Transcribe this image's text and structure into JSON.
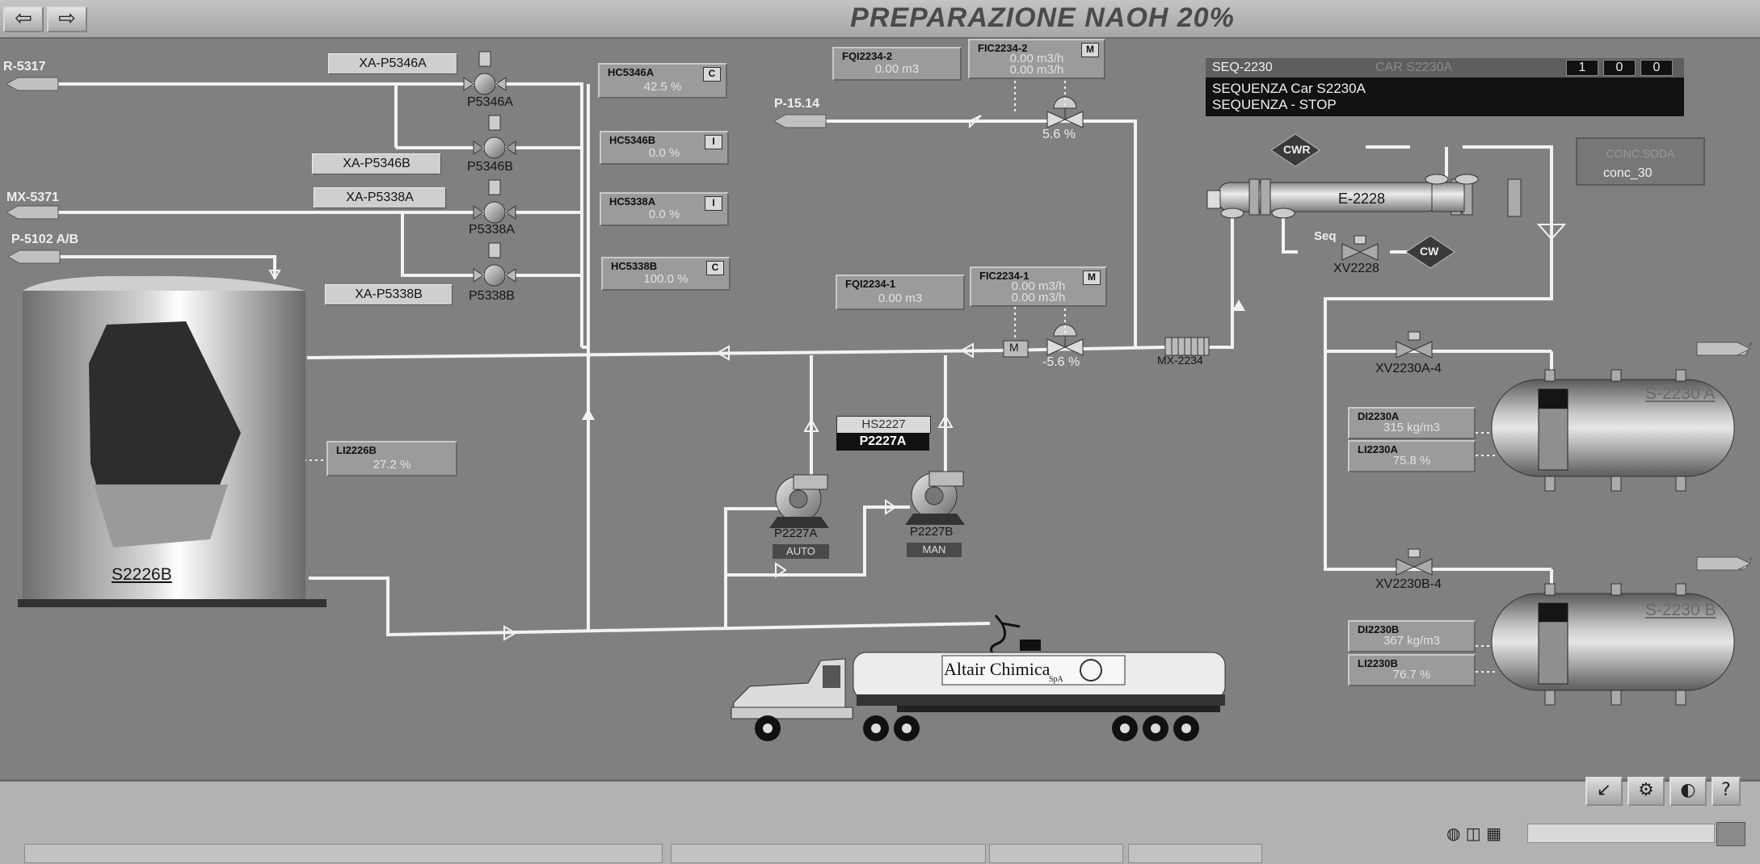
{
  "window": {
    "title": "PREPARAZIONE NAOH 20%",
    "nav_back": "⇦",
    "nav_forward": "⇨"
  },
  "lines": {
    "r5317": "R-5317",
    "mx5371": "MX-5371",
    "p5102": "P-5102 A/B",
    "p1514": "P-15.14"
  },
  "pumps": {
    "p5346a": {
      "tag": "P5346A",
      "xa": "XA-P5346A"
    },
    "p5346b": {
      "tag": "P5346B",
      "xa": "XA-P5346B"
    },
    "p5338a": {
      "tag": "P5338A",
      "xa": "XA-P5338A"
    },
    "p5338b": {
      "tag": "P5338B",
      "xa": "XA-P5338B"
    },
    "p2227a": {
      "tag": "P2227A",
      "mode": "AUTO"
    },
    "p2227b": {
      "tag": "P2227B",
      "mode": "MAN"
    }
  },
  "hand_controls": [
    {
      "tag": "HC5346A",
      "value": "42.5 %",
      "mode": "C"
    },
    {
      "tag": "HC5346B",
      "value": "0.0 %",
      "mode": "I"
    },
    {
      "tag": "HC5338A",
      "value": "0.0 %",
      "mode": "I"
    },
    {
      "tag": "HC5338B",
      "value": "100.0 %",
      "mode": "C"
    }
  ],
  "flow": {
    "fqi2234_2": {
      "tag": "FQI2234-2",
      "value": "0.00 m3"
    },
    "fic2234_2": {
      "tag": "FIC2234-2",
      "sp": "0.00 m3/h",
      "pv": "0.00 m3/h",
      "mode": "M",
      "valve": "5.6  %"
    },
    "fqi2234_1": {
      "tag": "FQI2234-1",
      "value": "0.00 m3"
    },
    "fic2234_1": {
      "tag": "FIC2234-1",
      "sp": "0.00 m3/h",
      "pv": "0.00 m3/h",
      "mode": "M",
      "valve": "-5.6  %"
    }
  },
  "mixer": "MX-2234",
  "motor": "M",
  "tank_s2226b": {
    "tag": "S2226B",
    "level_tag": "LI2226B",
    "level": "27.2 %",
    "level_fraction": 0.272
  },
  "hand_switch": {
    "tag": "HS2227",
    "value": "P2227A"
  },
  "sequence": {
    "id": "SEQ-2230",
    "car": "CAR S2230A",
    "counters": [
      "1",
      "0",
      "0"
    ],
    "line1": "SEQUENZA Car S2230A",
    "line2": "SEQUENZA - STOP"
  },
  "conc_box": {
    "title": "CONC.SODA",
    "value": "conc_30"
  },
  "exchanger": {
    "tag": "E-2228",
    "cwr": "CWR",
    "cw": "CW",
    "seq": "Seq",
    "valve": "XV2228"
  },
  "valves": {
    "xv2230a": "XV2230A-4",
    "xv2230b": "XV2230B-4"
  },
  "tank_a": {
    "tag": "S-2230 A",
    "density_tag": "DI2230A",
    "density": "315 kg/m3",
    "level_tag": "LI2230A",
    "level": "75.8 %",
    "level_fraction": 0.758
  },
  "tank_b": {
    "tag": "S-2230 B",
    "density_tag": "DI2230B",
    "density": "367 kg/m3",
    "level_tag": "LI2230B",
    "level": "76.7 %",
    "level_fraction": 0.767
  },
  "truck": {
    "brand": "Altair Chimica",
    "sub": "SpA"
  },
  "toolbar": {
    "b1": "↙",
    "b2": "⚙",
    "b3": "◐",
    "b4": "?"
  },
  "colors": {
    "background": "#808080",
    "pipe": "#f0f0f0",
    "panel": "#111111"
  }
}
